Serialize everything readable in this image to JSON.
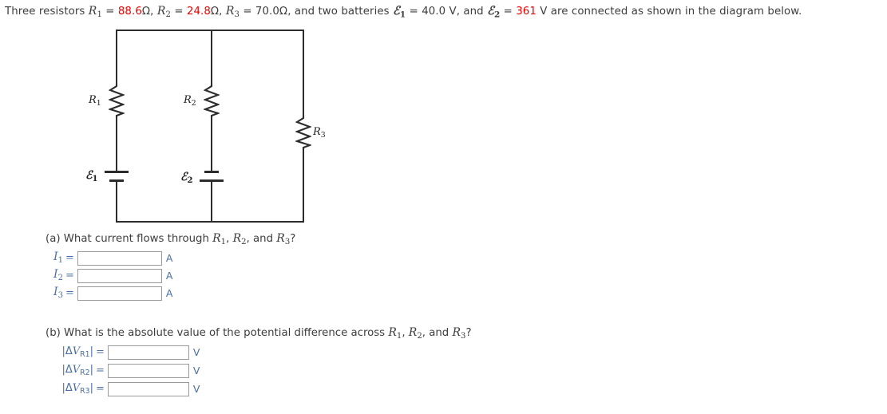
{
  "problem": {
    "lead": "Three resistors",
    "r1_sym": "R",
    "r1_sub": "1",
    "r1_value": "88.6",
    "r2_sym": "R",
    "r2_sub": "2",
    "r2_value": "24.8",
    "r3_sym": "R",
    "r3_sub": "3",
    "r3_value": "70.0",
    "ohm": "Ω",
    "mid": ", and two batteries",
    "emf_sym": "ℰ",
    "e1_sub": "1",
    "e1_value": "40.0",
    "e2_sub": "2",
    "e2_value": "361",
    "volt": "V",
    "eq": "=",
    "comma": ",",
    "tail": "are connected as shown in the diagram below.",
    "and": "and"
  },
  "diagram": {
    "label_r1": "R",
    "label_r1_sub": "1",
    "label_r2": "R",
    "label_r2_sub": "2",
    "label_r3": "R",
    "label_r3_sub": "3",
    "label_e1": "ℰ",
    "label_e1_sub": "1",
    "label_e2": "ℰ",
    "label_e2_sub": "2",
    "wire_color": "#2c2c2c"
  },
  "part_a": {
    "prompt_prefix": "(a) What current flows through ",
    "prompt_suffix": "?",
    "rows": [
      {
        "sym": "I",
        "sub": "1",
        "eq": "=",
        "value": "",
        "placeholder": "",
        "unit": "A"
      },
      {
        "sym": "I",
        "sub": "2",
        "eq": "=",
        "value": "",
        "placeholder": "",
        "unit": "A"
      },
      {
        "sym": "I",
        "sub": "3",
        "eq": "=",
        "value": "",
        "placeholder": "",
        "unit": "A"
      }
    ]
  },
  "part_b": {
    "prompt_prefix": "(b) What is the absolute value of the potential difference across ",
    "prompt_suffix": "?",
    "rows": [
      {
        "bar_open": "|",
        "delta": "Δ",
        "v": "V",
        "sub": "R1",
        "bar_close": "|",
        "eq": "=",
        "value": "",
        "placeholder": "",
        "unit": "V"
      },
      {
        "bar_open": "|",
        "delta": "Δ",
        "v": "V",
        "sub": "R2",
        "bar_close": "|",
        "eq": "=",
        "value": "",
        "placeholder": "",
        "unit": "V"
      },
      {
        "bar_open": "|",
        "delta": "Δ",
        "v": "V",
        "sub": "R3",
        "bar_close": "|",
        "eq": "=",
        "value": "",
        "placeholder": "",
        "unit": "V"
      }
    ]
  },
  "colors": {
    "value_red": "#ee0000",
    "label_blue": "#4a6fa5",
    "text_gray": "#3d3d3d"
  }
}
